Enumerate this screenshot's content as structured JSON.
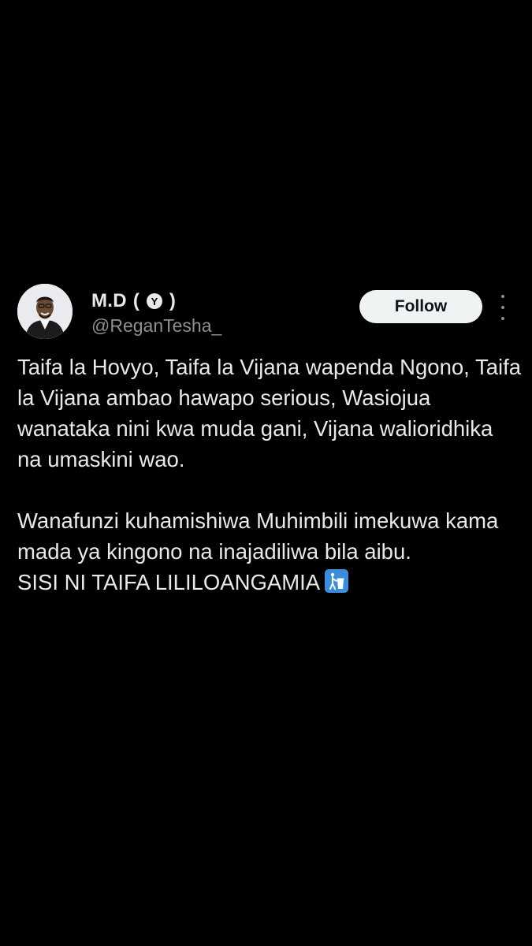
{
  "post": {
    "author": {
      "display_name": "M.D",
      "badge_letter": "Y",
      "handle": "@ReganTesha_",
      "avatar_icon": "person-avatar"
    },
    "follow_label": "Follow",
    "more_icon": "more-vertical-icon",
    "paragraph_1": "Taifa la Hovyo, Taifa la Vijana wapenda Ngono, Taifa la Vijana ambao hawapo serious, Wasiojua wanataka nini kwa muda gani, Vijana walioridhika na umaskini wao.",
    "line_2a": "Wanafunzi kuhamishiwa Muhimbili imekuwa kama mada ya kingono na inajadiliwa bila aibu.",
    "line_2b": "SISI NI TAIFA LILILOANGAMIA",
    "emoji": "put-litter-in-its-place-icon"
  },
  "colors": {
    "background": "#000000",
    "text": "#e7e9ea",
    "secondary": "#8b9096",
    "button_bg": "#eff3f4",
    "emoji_bg": "#3b8ddb"
  }
}
